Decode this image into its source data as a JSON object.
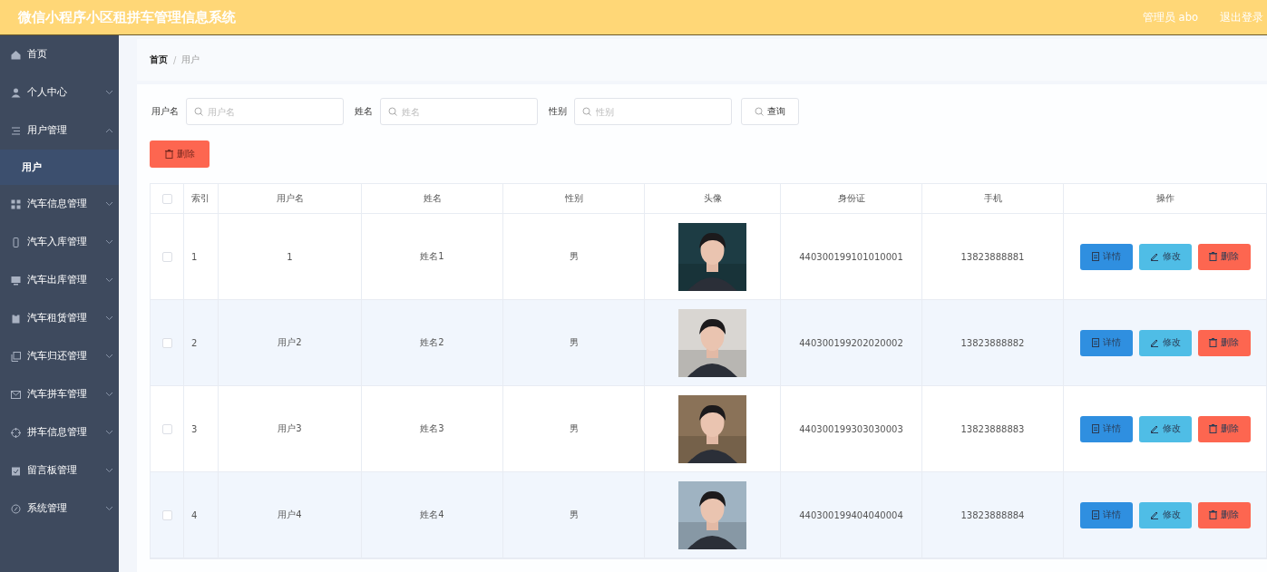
{
  "header": {
    "title": "微信小程序小区租拼车管理信息系统",
    "user": "管理员 abo",
    "logout": "退出登录"
  },
  "sidebar": {
    "items": [
      {
        "label": "首页"
      },
      {
        "label": "个人中心",
        "expanded": false
      },
      {
        "label": "用户管理",
        "expanded": true,
        "children": [
          {
            "label": "用户",
            "selected": true
          }
        ]
      },
      {
        "label": "汽车信息管理",
        "expanded": false
      },
      {
        "label": "汽车入库管理",
        "expanded": false
      },
      {
        "label": "汽车出库管理",
        "expanded": false
      },
      {
        "label": "汽车租赁管理",
        "expanded": false
      },
      {
        "label": "汽车归还管理",
        "expanded": false
      },
      {
        "label": "汽车拼车管理",
        "expanded": false
      },
      {
        "label": "拼车信息管理",
        "expanded": false
      },
      {
        "label": "留言板管理",
        "expanded": false
      },
      {
        "label": "系统管理",
        "expanded": false
      }
    ]
  },
  "breadcrumb": [
    "首页",
    "/",
    "用户"
  ],
  "search": {
    "fields": [
      {
        "label": "用户名",
        "placeholder": "用户名"
      },
      {
        "label": "姓名",
        "placeholder": "姓名"
      },
      {
        "label": "性别",
        "placeholder": "性别"
      }
    ],
    "button": "查询"
  },
  "delete_button": "删除",
  "table": {
    "columns": [
      "索引",
      "用户名",
      "姓名",
      "性别",
      "头像",
      "身份证",
      "手机",
      "操作"
    ],
    "header_checked": false,
    "rows": [
      {
        "checked": false,
        "cells": [
          "1",
          "1",
          "姓名1",
          "男"
        ],
        "id": "440300199101010001",
        "phone": "13823888881",
        "actions": [
          "详情",
          "修改",
          "删除"
        ]
      },
      {
        "checked": false,
        "cells": [
          "2",
          "用户2",
          "姓名2",
          "男"
        ],
        "id": "440300199202020002",
        "phone": "13823888882",
        "actions": [
          "详情",
          "修改",
          "删除"
        ]
      },
      {
        "checked": false,
        "cells": [
          "3",
          "用户3",
          "姓名3",
          "男"
        ],
        "id": "440300199303030003",
        "phone": "13823888883",
        "actions": [
          "详情",
          "修改",
          "删除"
        ]
      },
      {
        "checked": false,
        "cells": [
          "4",
          "用户4",
          "姓名4",
          "男"
        ],
        "id": "440300199404040004",
        "phone": "13823888884",
        "actions": [
          "详情",
          "修改",
          "删除"
        ]
      }
    ]
  }
}
